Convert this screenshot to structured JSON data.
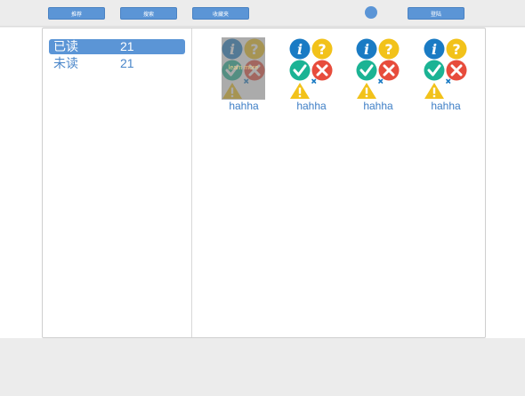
{
  "nav": {
    "buttons": [
      {
        "label": "推荐"
      },
      {
        "label": "搜索"
      },
      {
        "label": "收藏夹"
      }
    ],
    "login_label": "登陆"
  },
  "sidebar": {
    "items": [
      {
        "label": "已读",
        "count": "21"
      },
      {
        "label": "未读",
        "count": "21"
      }
    ]
  },
  "grid": {
    "items": [
      {
        "caption": "hahha",
        "overlay": "learn more"
      },
      {
        "caption": "hahha"
      },
      {
        "caption": "hahha"
      },
      {
        "caption": "hahha"
      }
    ]
  },
  "colors": {
    "accent": "#5b95d6",
    "info": "#1a7bc4",
    "question": "#f2c21a",
    "check": "#1bb394",
    "error": "#e74c3c",
    "warning": "#f2c21a"
  }
}
